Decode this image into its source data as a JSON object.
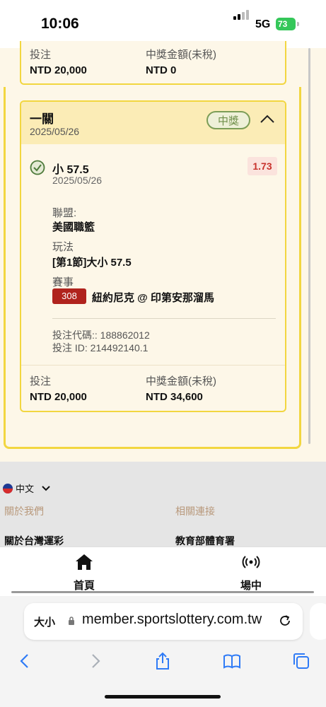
{
  "status_bar": {
    "time": "10:06",
    "network": "5G",
    "battery": "73"
  },
  "previous_bet": {
    "stake_label": "投注",
    "stake_value": "NTD 20,000",
    "payout_label": "中獎金額(未稅)",
    "payout_value": "NTD 0"
  },
  "bet_card": {
    "title": "一關",
    "date": "2025/05/26",
    "status_badge": "中獎",
    "selection": {
      "name": "小 57.5",
      "date": "2025/05/26",
      "odds": "1.73"
    },
    "league_label": "聯盟:",
    "league_value": "美國職籃",
    "play_label": "玩法",
    "play_value": "[第1節]大小 57.5",
    "event_label": "賽事",
    "event_number": "308",
    "event_name": "紐約尼克 @ 印第安那溜馬",
    "bet_code": "投注代碼:: 188862012",
    "bet_id": "投注 ID: 214492140.1",
    "stake_label": "投注",
    "stake_value": "NTD 20,000",
    "payout_label": "中獎金額(未稅)",
    "payout_value": "NTD 34,600"
  },
  "footer": {
    "language": "中文",
    "about_heading": "關於我們",
    "links_heading": "相關連接",
    "about_link": "關於台灣運彩",
    "links_link": "教育部體育署"
  },
  "tabbar": {
    "home": "首頁",
    "live": "場中"
  },
  "browser": {
    "text_size": "大小",
    "url": "member.sportslottery.com.tw"
  },
  "colors": {
    "accent_yellow": "#f2d640",
    "win_green": "#6f8f4a",
    "odds_red": "#c8322b",
    "event_red": "#b0231d"
  }
}
